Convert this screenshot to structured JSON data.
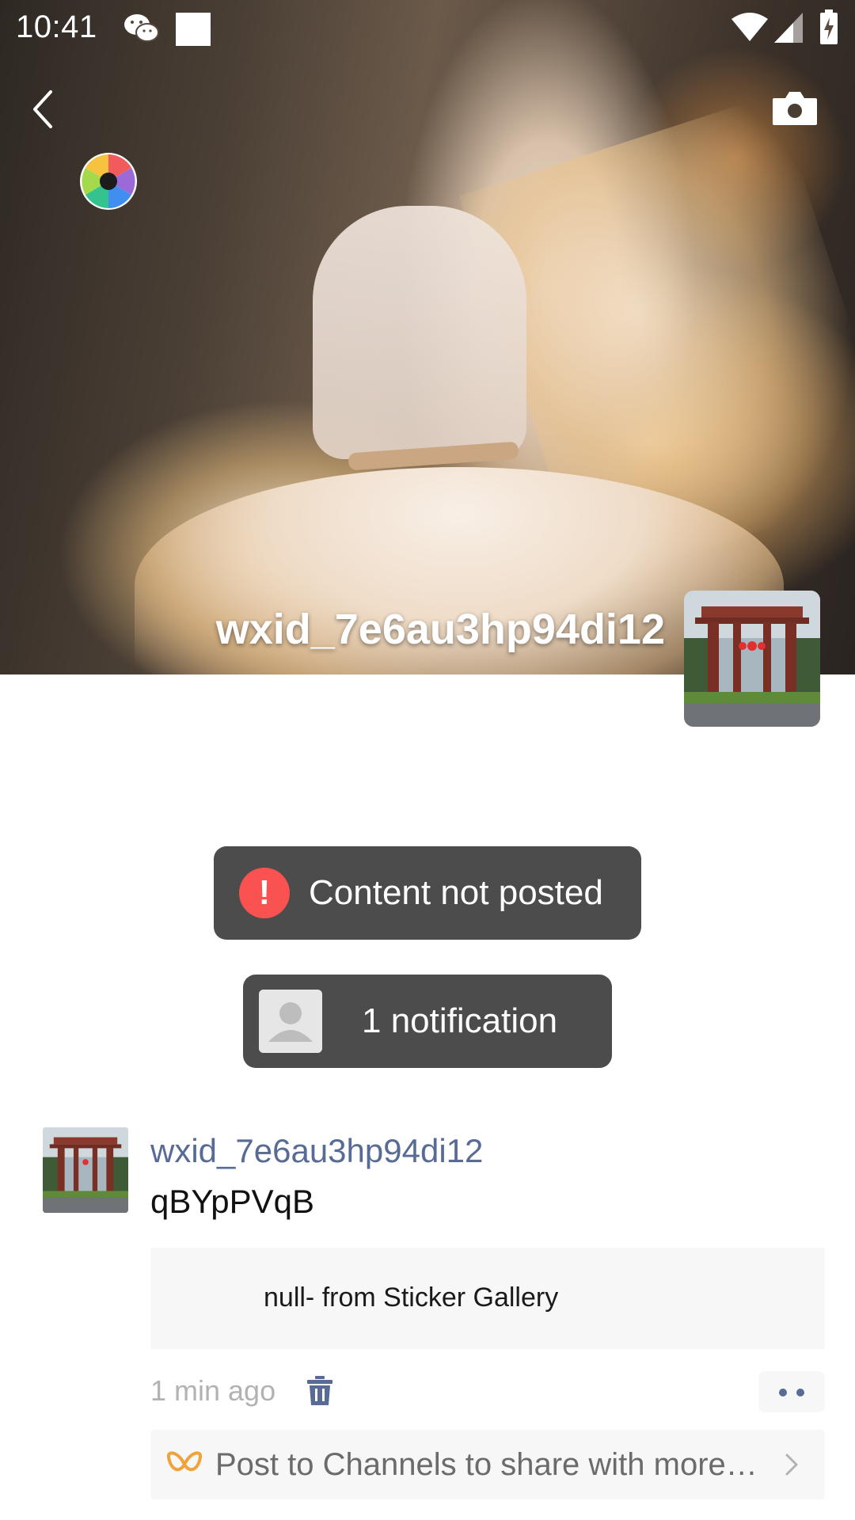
{
  "status_bar": {
    "time": "10:41"
  },
  "cover": {
    "username": "wxid_7e6au3hp94di12"
  },
  "toasts": {
    "error_text": "Content not posted",
    "notification_text": "1 notification"
  },
  "post": {
    "author": "wxid_7e6au3hp94di12",
    "text": "qBYpPVqB",
    "sticker_caption": "null- from Sticker Gallery",
    "time": "1 min ago",
    "channels_prompt": "Post to Channels to share with more…"
  },
  "colors": {
    "link_blue": "#576b95",
    "error_red": "#fa5151",
    "toast_bg": "#4c4c4c",
    "channels_orange": "#f0a23b"
  },
  "icons": [
    "back-arrow-icon",
    "camera-icon",
    "aperture-icon",
    "wechat-icon",
    "wifi-icon",
    "signal-icon",
    "battery-icon",
    "exclamation-icon",
    "person-icon",
    "trash-icon",
    "more-dots-icon",
    "channels-butterfly-icon",
    "chevron-right-icon"
  ]
}
